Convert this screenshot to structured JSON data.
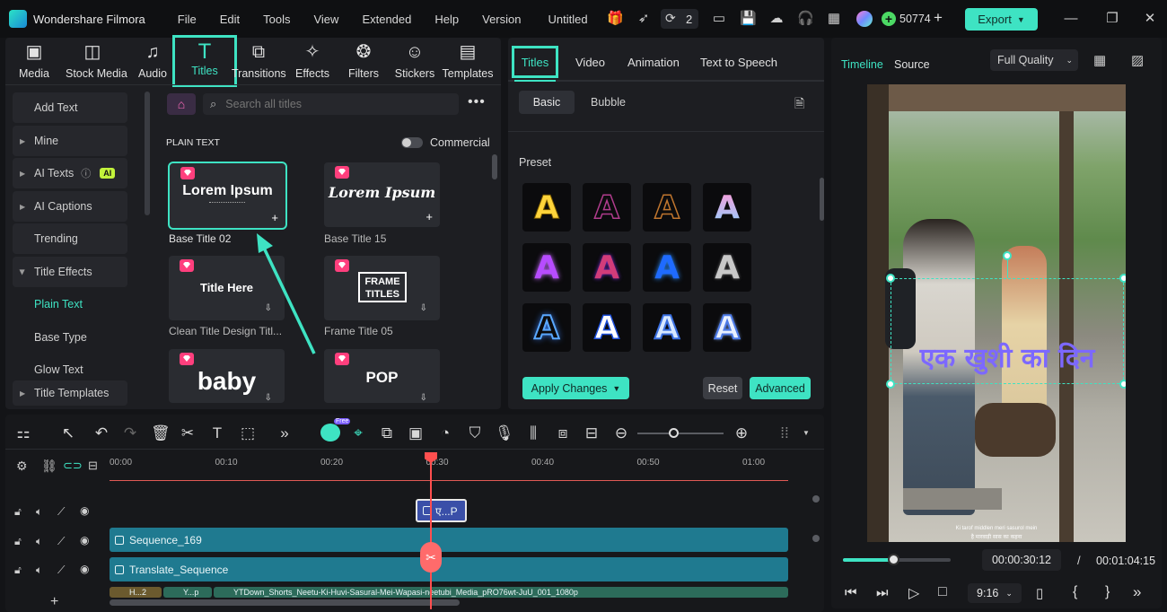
{
  "app": {
    "name": "Wondershare Filmora",
    "project": "Untitled",
    "notif_count": "2",
    "credits": "50774",
    "export_label": "Export"
  },
  "menu": [
    "File",
    "Edit",
    "Tools",
    "View",
    "Extended",
    "Help",
    "Version"
  ],
  "categories": [
    "Media",
    "Stock Media",
    "Audio",
    "Titles",
    "Transitions",
    "Effects",
    "Filters",
    "Stickers",
    "Templates"
  ],
  "sidebar": [
    "Add Text",
    "Mine",
    "AI Texts",
    "AI Captions",
    "Trending",
    "Title Effects",
    "Plain Text",
    "Base Type",
    "Glow Text",
    "Title Templates"
  ],
  "ai_badge": "AI",
  "search": {
    "placeholder": "Search all titles"
  },
  "section": {
    "heading": "PLAIN TEXT",
    "toggle_label": "Commercial"
  },
  "titles": [
    {
      "caption": "Base Title 02",
      "preview": "Lorem Ipsum"
    },
    {
      "caption": "Base Title 15",
      "preview": "Lorem Ipsum"
    },
    {
      "caption": "Clean Title Design Titl...",
      "preview": "Title Here"
    },
    {
      "caption": "Frame Title 05",
      "preview": "FRAME TITLES"
    },
    {
      "caption": "",
      "preview": "baby"
    },
    {
      "caption": "",
      "preview": "POP"
    }
  ],
  "props": {
    "tabs": [
      "Titles",
      "Video",
      "Animation",
      "Text to Speech"
    ],
    "subtabs": [
      "Basic",
      "Bubble"
    ],
    "preset_label": "Preset",
    "preset_glyph": "A",
    "apply_label": "Apply Changes",
    "reset_label": "Reset",
    "advanced_label": "Advanced"
  },
  "viewer": {
    "tabs": [
      "Timeline",
      "Source"
    ],
    "quality": "Full Quality",
    "overlay_text": "एक खुशी का दिन",
    "caption_line1": "Ki tarof middlen meri sasurol mein",
    "caption_line2": "है मारवाड़ी सास का कहना",
    "current_time": "00:00:30:12",
    "separator": "/",
    "total_time": "00:01:04:15",
    "aspect": "9:16",
    "progress": 0.47
  },
  "timeline": {
    "ruler": [
      "00:00",
      "00:10",
      "00:20",
      "00:30",
      "00:40",
      "00:50",
      "01:00"
    ],
    "title_clip": "ए...P",
    "clips": [
      "Sequence_169",
      "Translate_Sequence"
    ],
    "bottom_clips": [
      "H...2",
      "Y...p",
      "YTDown_Shorts_Neetu-Ki-Huvi-Sasural-Mei-Wapasi-neetubi_Media_pRO76wt-JuU_001_1080p"
    ],
    "free_badge": "Free",
    "zoom": 0.42
  }
}
